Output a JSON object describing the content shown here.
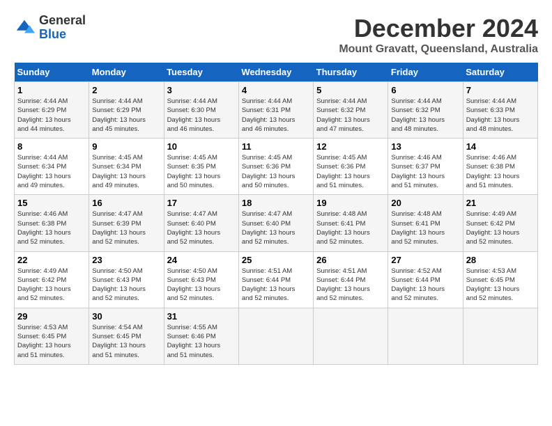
{
  "header": {
    "logo": {
      "general": "General",
      "blue": "Blue"
    },
    "title": "December 2024",
    "location": "Mount Gravatt, Queensland, Australia"
  },
  "calendar": {
    "headers": [
      "Sunday",
      "Monday",
      "Tuesday",
      "Wednesday",
      "Thursday",
      "Friday",
      "Saturday"
    ],
    "weeks": [
      [
        {
          "day": "",
          "info": ""
        },
        {
          "day": "2",
          "info": "Sunrise: 4:44 AM\nSunset: 6:29 PM\nDaylight: 13 hours\nand 45 minutes."
        },
        {
          "day": "3",
          "info": "Sunrise: 4:44 AM\nSunset: 6:30 PM\nDaylight: 13 hours\nand 46 minutes."
        },
        {
          "day": "4",
          "info": "Sunrise: 4:44 AM\nSunset: 6:31 PM\nDaylight: 13 hours\nand 46 minutes."
        },
        {
          "day": "5",
          "info": "Sunrise: 4:44 AM\nSunset: 6:32 PM\nDaylight: 13 hours\nand 47 minutes."
        },
        {
          "day": "6",
          "info": "Sunrise: 4:44 AM\nSunset: 6:32 PM\nDaylight: 13 hours\nand 48 minutes."
        },
        {
          "day": "7",
          "info": "Sunrise: 4:44 AM\nSunset: 6:33 PM\nDaylight: 13 hours\nand 48 minutes."
        }
      ],
      [
        {
          "day": "1",
          "info": "Sunrise: 4:44 AM\nSunset: 6:29 PM\nDaylight: 13 hours\nand 44 minutes."
        },
        {
          "day": "",
          "info": ""
        },
        {
          "day": "",
          "info": ""
        },
        {
          "day": "",
          "info": ""
        },
        {
          "day": "",
          "info": ""
        },
        {
          "day": "",
          "info": ""
        },
        {
          "day": "",
          "info": ""
        }
      ],
      [
        {
          "day": "8",
          "info": "Sunrise: 4:44 AM\nSunset: 6:34 PM\nDaylight: 13 hours\nand 49 minutes."
        },
        {
          "day": "9",
          "info": "Sunrise: 4:45 AM\nSunset: 6:34 PM\nDaylight: 13 hours\nand 49 minutes."
        },
        {
          "day": "10",
          "info": "Sunrise: 4:45 AM\nSunset: 6:35 PM\nDaylight: 13 hours\nand 50 minutes."
        },
        {
          "day": "11",
          "info": "Sunrise: 4:45 AM\nSunset: 6:36 PM\nDaylight: 13 hours\nand 50 minutes."
        },
        {
          "day": "12",
          "info": "Sunrise: 4:45 AM\nSunset: 6:36 PM\nDaylight: 13 hours\nand 51 minutes."
        },
        {
          "day": "13",
          "info": "Sunrise: 4:46 AM\nSunset: 6:37 PM\nDaylight: 13 hours\nand 51 minutes."
        },
        {
          "day": "14",
          "info": "Sunrise: 4:46 AM\nSunset: 6:38 PM\nDaylight: 13 hours\nand 51 minutes."
        }
      ],
      [
        {
          "day": "15",
          "info": "Sunrise: 4:46 AM\nSunset: 6:38 PM\nDaylight: 13 hours\nand 52 minutes."
        },
        {
          "day": "16",
          "info": "Sunrise: 4:47 AM\nSunset: 6:39 PM\nDaylight: 13 hours\nand 52 minutes."
        },
        {
          "day": "17",
          "info": "Sunrise: 4:47 AM\nSunset: 6:40 PM\nDaylight: 13 hours\nand 52 minutes."
        },
        {
          "day": "18",
          "info": "Sunrise: 4:47 AM\nSunset: 6:40 PM\nDaylight: 13 hours\nand 52 minutes."
        },
        {
          "day": "19",
          "info": "Sunrise: 4:48 AM\nSunset: 6:41 PM\nDaylight: 13 hours\nand 52 minutes."
        },
        {
          "day": "20",
          "info": "Sunrise: 4:48 AM\nSunset: 6:41 PM\nDaylight: 13 hours\nand 52 minutes."
        },
        {
          "day": "21",
          "info": "Sunrise: 4:49 AM\nSunset: 6:42 PM\nDaylight: 13 hours\nand 52 minutes."
        }
      ],
      [
        {
          "day": "22",
          "info": "Sunrise: 4:49 AM\nSunset: 6:42 PM\nDaylight: 13 hours\nand 52 minutes."
        },
        {
          "day": "23",
          "info": "Sunrise: 4:50 AM\nSunset: 6:43 PM\nDaylight: 13 hours\nand 52 minutes."
        },
        {
          "day": "24",
          "info": "Sunrise: 4:50 AM\nSunset: 6:43 PM\nDaylight: 13 hours\nand 52 minutes."
        },
        {
          "day": "25",
          "info": "Sunrise: 4:51 AM\nSunset: 6:44 PM\nDaylight: 13 hours\nand 52 minutes."
        },
        {
          "day": "26",
          "info": "Sunrise: 4:51 AM\nSunset: 6:44 PM\nDaylight: 13 hours\nand 52 minutes."
        },
        {
          "day": "27",
          "info": "Sunrise: 4:52 AM\nSunset: 6:44 PM\nDaylight: 13 hours\nand 52 minutes."
        },
        {
          "day": "28",
          "info": "Sunrise: 4:53 AM\nSunset: 6:45 PM\nDaylight: 13 hours\nand 52 minutes."
        }
      ],
      [
        {
          "day": "29",
          "info": "Sunrise: 4:53 AM\nSunset: 6:45 PM\nDaylight: 13 hours\nand 51 minutes."
        },
        {
          "day": "30",
          "info": "Sunrise: 4:54 AM\nSunset: 6:45 PM\nDaylight: 13 hours\nand 51 minutes."
        },
        {
          "day": "31",
          "info": "Sunrise: 4:55 AM\nSunset: 6:46 PM\nDaylight: 13 hours\nand 51 minutes."
        },
        {
          "day": "",
          "info": ""
        },
        {
          "day": "",
          "info": ""
        },
        {
          "day": "",
          "info": ""
        },
        {
          "day": "",
          "info": ""
        }
      ]
    ]
  }
}
